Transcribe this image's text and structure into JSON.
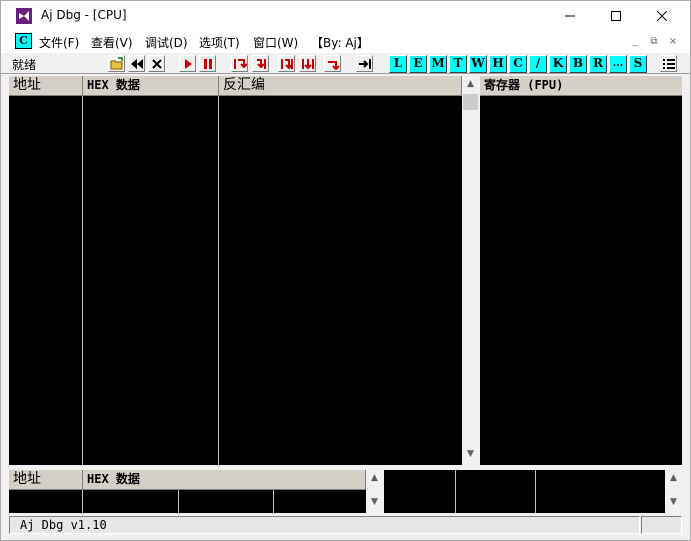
{
  "window": {
    "title": "Aj Dbg - [CPU]",
    "app_icon": "visual-studio-icon",
    "controls": [
      "minimize-icon",
      "maximize-icon",
      "close-icon"
    ]
  },
  "menu": {
    "icon_letter": "C",
    "items": [
      "文件(F)",
      "查看(V)",
      "调试(D)",
      "选项(T)",
      "窗口(W)",
      "【By: Aj】"
    ],
    "mdi_controls": [
      "_",
      "⧉",
      "×"
    ]
  },
  "toolbar": {
    "status": "就绪",
    "icon_buttons": [
      "open-folder-icon",
      "rewind-icon",
      "stop-x-icon",
      "run-icon",
      "pause-icon",
      "step-into-icon",
      "step-over-icon",
      "trace-into-icon",
      "trace-over-icon",
      "execute-till-return-icon",
      "goto-icon"
    ],
    "letter_buttons": [
      "L",
      "E",
      "M",
      "T",
      "W",
      "H",
      "C",
      "/",
      "K",
      "B",
      "R",
      "...",
      "S"
    ],
    "right_icon": "list-icon"
  },
  "disasm_pane": {
    "col_address": "地址",
    "col_hex": "HEX 数据",
    "col_disasm": "反汇编"
  },
  "register_pane": {
    "title": "寄存器 (FPU)"
  },
  "dump_pane": {
    "col_address": "地址",
    "col_hex": "HEX 数据"
  },
  "statusbar": {
    "text": "Aj Dbg v1.10"
  }
}
